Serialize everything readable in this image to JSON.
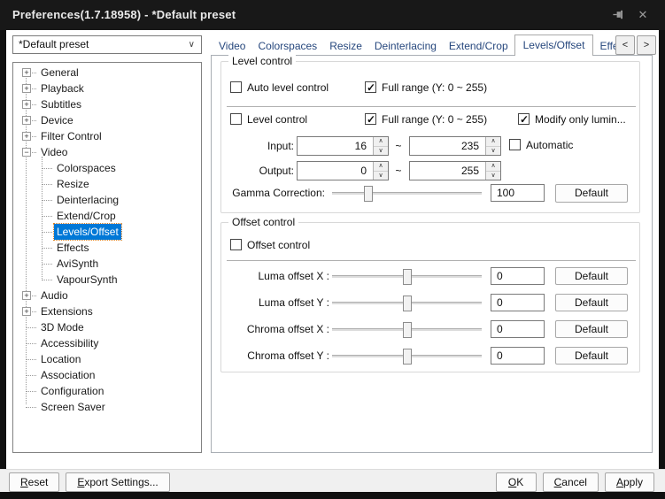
{
  "window": {
    "title": "Preferences(1.7.18958) - *Default preset",
    "close_icon": "✕"
  },
  "preset_dropdown": {
    "value": "*Default preset"
  },
  "tree": {
    "items": [
      {
        "label": "General",
        "glyph": "+",
        "child": false,
        "selected": false
      },
      {
        "label": "Playback",
        "glyph": "+",
        "child": false,
        "selected": false
      },
      {
        "label": "Subtitles",
        "glyph": "+",
        "child": false,
        "selected": false
      },
      {
        "label": "Device",
        "glyph": "+",
        "child": false,
        "selected": false
      },
      {
        "label": "Filter Control",
        "glyph": "+",
        "child": false,
        "selected": false
      },
      {
        "label": "Video",
        "glyph": "−",
        "child": false,
        "selected": false
      },
      {
        "label": "Colorspaces",
        "glyph": "",
        "child": true,
        "selected": false
      },
      {
        "label": "Resize",
        "glyph": "",
        "child": true,
        "selected": false
      },
      {
        "label": "Deinterlacing",
        "glyph": "",
        "child": true,
        "selected": false
      },
      {
        "label": "Extend/Crop",
        "glyph": "",
        "child": true,
        "selected": false
      },
      {
        "label": "Levels/Offset",
        "glyph": "",
        "child": true,
        "selected": true
      },
      {
        "label": "Effects",
        "glyph": "",
        "child": true,
        "selected": false
      },
      {
        "label": "AviSynth",
        "glyph": "",
        "child": true,
        "selected": false
      },
      {
        "label": "VapourSynth",
        "glyph": "",
        "child": true,
        "selected": false
      },
      {
        "label": "Audio",
        "glyph": "+",
        "child": false,
        "selected": false
      },
      {
        "label": "Extensions",
        "glyph": "+",
        "child": false,
        "selected": false
      },
      {
        "label": "3D Mode",
        "glyph": "",
        "child": false,
        "selected": false
      },
      {
        "label": "Accessibility",
        "glyph": "",
        "child": false,
        "selected": false
      },
      {
        "label": "Location",
        "glyph": "",
        "child": false,
        "selected": false
      },
      {
        "label": "Association",
        "glyph": "",
        "child": false,
        "selected": false
      },
      {
        "label": "Configuration",
        "glyph": "",
        "child": false,
        "selected": false
      },
      {
        "label": "Screen Saver",
        "glyph": "",
        "child": false,
        "selected": false
      }
    ]
  },
  "tabs": {
    "items": [
      {
        "label": "Video",
        "active": false
      },
      {
        "label": "Colorspaces",
        "active": false
      },
      {
        "label": "Resize",
        "active": false
      },
      {
        "label": "Deinterlacing",
        "active": false
      },
      {
        "label": "Extend/Crop",
        "active": false
      },
      {
        "label": "Levels/Offset",
        "active": true
      },
      {
        "label": "Effects",
        "active": false
      }
    ],
    "scroll_left": "<",
    "scroll_right": ">"
  },
  "level_control": {
    "group_title": "Level control",
    "auto_level": {
      "label": "Auto level control",
      "checked": false
    },
    "full_range_top": {
      "label": "Full range (Y: 0 ~ 255)",
      "checked": true
    },
    "level_control_cb": {
      "label": "Level control",
      "checked": false
    },
    "full_range": {
      "label": "Full range (Y: 0 ~ 255)",
      "checked": true
    },
    "modify_luma": {
      "label": "Modify only lumin...",
      "checked": true
    },
    "input": {
      "label": "Input:",
      "low": "16",
      "high": "235",
      "tilde": "~",
      "automatic": {
        "label": "Automatic",
        "checked": false
      }
    },
    "output": {
      "label": "Output:",
      "low": "0",
      "high": "255",
      "tilde": "~"
    },
    "gamma": {
      "label": "Gamma Correction:",
      "value": "100",
      "default_label": "Default",
      "slider_pos": 0.24
    }
  },
  "offset_control": {
    "group_title": "Offset control",
    "checkbox": {
      "label": "Offset control",
      "checked": false
    },
    "rows": [
      {
        "label": "Luma offset X :",
        "value": "0",
        "default_label": "Default",
        "slider_pos": 0.5
      },
      {
        "label": "Luma offset Y :",
        "value": "0",
        "default_label": "Default",
        "slider_pos": 0.5
      },
      {
        "label": "Chroma offset X :",
        "value": "0",
        "default_label": "Default",
        "slider_pos": 0.5
      },
      {
        "label": "Chroma offset Y :",
        "value": "0",
        "default_label": "Default",
        "slider_pos": 0.5
      }
    ]
  },
  "footer": {
    "left_buttons": [
      {
        "m": "R",
        "rest": "eset"
      },
      {
        "m": "E",
        "rest": "xport Settings..."
      }
    ],
    "right_buttons": [
      {
        "m": "O",
        "rest": "K"
      },
      {
        "m": "C",
        "rest": "ancel"
      },
      {
        "m": "A",
        "rest": "pply"
      }
    ]
  },
  "colors": {
    "titlebar": "#181818",
    "selection": "#0078d7",
    "tab_text": "#26477d",
    "footer_bg": "#f0f0f0"
  }
}
